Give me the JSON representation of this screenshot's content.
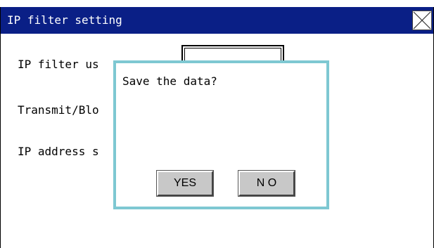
{
  "window": {
    "title": "IP filter setting",
    "close_icon": "close-x-icon"
  },
  "fields": {
    "ip_filter_use_label": "IP filter us",
    "transmit_block_label": "Transmit/Blo",
    "ip_address_label": "IP address s",
    "ip_filter_use_value": ""
  },
  "dialog": {
    "message": "Save the data?",
    "yes_label": "YES",
    "no_label": "N O"
  },
  "colors": {
    "titlebar": "#0a1f86",
    "dialog_border": "#7ec8d2",
    "button_face": "#c8c8c8"
  }
}
